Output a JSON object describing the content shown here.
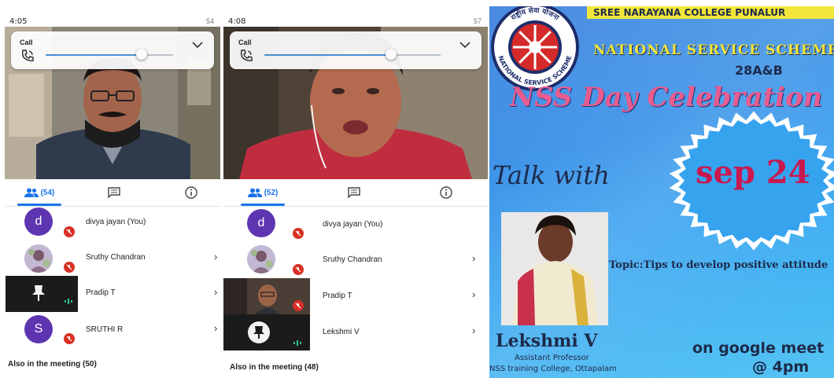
{
  "phone1": {
    "status_time": "4:05",
    "status_right": "54",
    "call_label": "Call",
    "slider_level": 0.75,
    "participants_count": "(54)",
    "participants": [
      {
        "avatar": "d",
        "name": "divya jayan (You)",
        "avatar_color": "#5e35b1"
      },
      {
        "avatar": "",
        "name": "Sruthy Chandran",
        "avatar_color": "#b0a8c6"
      },
      {
        "avatar": "",
        "name": "Pradip T",
        "avatar_color": "#1b1b1b"
      },
      {
        "avatar": "S",
        "name": "SRUTHI R",
        "avatar_color": "#5e35b1"
      }
    ],
    "also_in_meeting": "Also in the meeting (50)"
  },
  "phone2": {
    "status_time": "4:08",
    "status_right": "57",
    "call_label": "Call",
    "slider_level": 0.72,
    "participants_count": "(52)",
    "participants": [
      {
        "avatar": "d",
        "name": "divya jayan (You)",
        "avatar_color": "#5e35b1"
      },
      {
        "avatar": "",
        "name": "Sruthy Chandran",
        "avatar_color": "#b0a8c6"
      },
      {
        "avatar": "",
        "name": "Pradip T",
        "avatar_color": "#3a3230"
      },
      {
        "avatar": "",
        "name": "Lekshmi V",
        "avatar_color": "#1b1b1b"
      }
    ],
    "also_in_meeting": "Also in the meeting (48)"
  },
  "poster": {
    "college": "SREE NARAYANA COLLEGE PUNALUR",
    "logo_text_top": "राष्ट्रीय सेवा योजना",
    "logo_text_bottom": "NATIONAL SERVICE SCHEME",
    "scheme": "NATIONAL SERVICE SCHEME",
    "units": "28A&B",
    "event": "NSS Day Celebration",
    "talk_with": "Talk with",
    "date": "sep 24",
    "topic": "Topic:Tips to develop positive attitude",
    "speaker": "Lekshmi V",
    "designation": "Assistant Professor",
    "institution": "NSS training College, Ottapalam",
    "platform": "on google meet",
    "time": "@ 4pm",
    "colors": {
      "bg": "#2f9ae8",
      "title": "#e85c8f",
      "yellow": "#f2e63a",
      "dark": "#1e2a4a"
    }
  }
}
